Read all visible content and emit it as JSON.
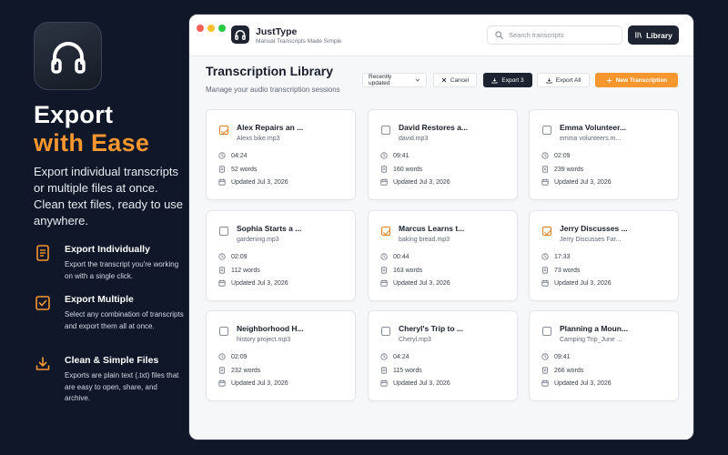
{
  "promo": {
    "headline_1": "Export",
    "headline_2": "with Ease",
    "intro": "Export individual transcripts or multiple files at once. Clean text files, ready to use anywhere.",
    "features": [
      {
        "icon": "document-icon",
        "title": "Export Individually",
        "desc": "Export the transcript you're working on with a single click."
      },
      {
        "icon": "checkbox-icon",
        "title": "Export  Multiple",
        "desc": "Select any combination of transcripts and export them all at once."
      },
      {
        "icon": "download-icon",
        "title": "Clean & Simple Files",
        "desc": "Exports are plain text (.txt) files that are easy to open, share, and archive."
      }
    ],
    "accent_color": "#f5962f"
  },
  "app": {
    "name": "JustType",
    "subtitle": "Manual Transcripts Made Simple",
    "search_placeholder": "Search transcripts",
    "library_label": "Library"
  },
  "page": {
    "title": "Transcription Library",
    "subtitle": "Manage your audio transcription sessions"
  },
  "toolbar": {
    "sort_label": "Recently updated",
    "cancel_label": "Cancel",
    "export_selected_label": "Export 3",
    "export_all_label": "Export All",
    "new_label": "New Transcription"
  },
  "cards": [
    {
      "title": "Alex Repairs an ...",
      "file": "Alexs bike.mp3",
      "duration": "04:24",
      "words": "52 words",
      "updated": "Updated Jul 3, 2026",
      "checked": true
    },
    {
      "title": "David Restores a...",
      "file": "david.mp3",
      "duration": "09:41",
      "words": "160 words",
      "updated": "Updated Jul 3, 2026",
      "checked": false
    },
    {
      "title": "Emma Volunteer...",
      "file": "emma volunteers.m...",
      "duration": "02:09",
      "words": "239 words",
      "updated": "Updated Jul 3, 2026",
      "checked": false
    },
    {
      "title": "Sophia Starts a ...",
      "file": "gardening.mp3",
      "duration": "02:09",
      "words": "112 words",
      "updated": "Updated Jul 3, 2026",
      "checked": false
    },
    {
      "title": "Marcus Learns t...",
      "file": "baking bread.mp3",
      "duration": "00:44",
      "words": "163 words",
      "updated": "Updated Jul 3, 2026",
      "checked": true
    },
    {
      "title": "Jerry Discusses ...",
      "file": "Jerry Discusses Far...",
      "duration": "17:33",
      "words": "73 words",
      "updated": "Updated Jul 3, 2026",
      "checked": true
    },
    {
      "title": "Neighborhood H...",
      "file": "history project.mp3",
      "duration": "02:09",
      "words": "232 words",
      "updated": "Updated Jul 3, 2026",
      "checked": false
    },
    {
      "title": "Cheryl's Trip to ...",
      "file": "Cheryl.mp3",
      "duration": "04:24",
      "words": "115 words",
      "updated": "Updated Jul 3, 2026",
      "checked": false
    },
    {
      "title": "Planning a Moun...",
      "file": "Camping Trip_June ...",
      "duration": "09:41",
      "words": "266 words",
      "updated": "Updated Jul 3, 2026",
      "checked": false
    }
  ]
}
